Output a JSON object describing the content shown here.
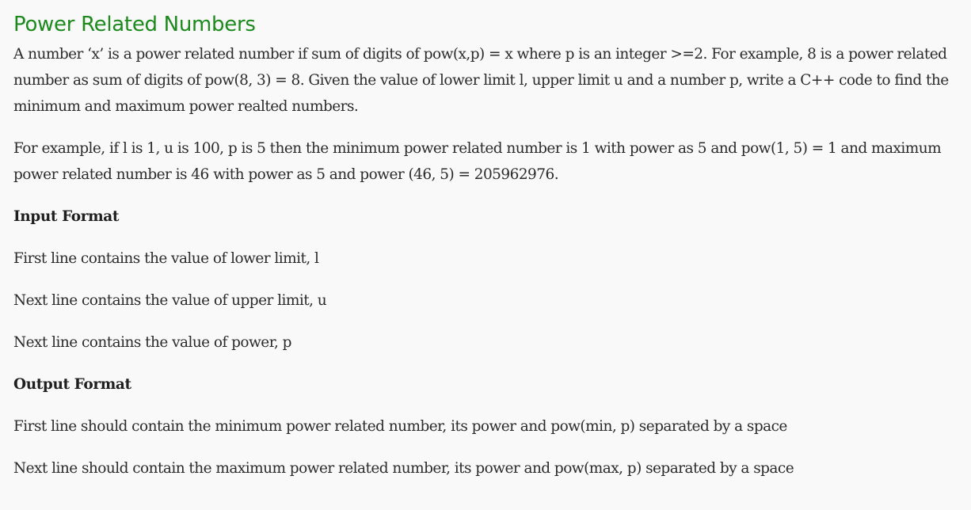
{
  "problem": {
    "title": "Power Related Numbers",
    "intro": "A number ‘x’ is a power related number if sum of digits of pow(x,p) = x where p is an integer >=2. For example, 8 is a power related number as sum of digits of pow(8, 3) = 8. Given the value of lower limit l, upper limit u and a number p, write a C++ code to find the minimum and maximum power realted numbers.",
    "example": "For example, if l is 1, u is 100, p is 5 then the minimum power related number is 1 with power as 5 and pow(1, 5) = 1 and maximum power related number is 46 with power as 5 and power (46, 5) = 205962976.",
    "input_heading": "Input Format",
    "input_lines": [
      "First line contains the value of lower limit, l",
      "Next line contains the value of upper limit, u",
      "Next line contains the value of power, p"
    ],
    "output_heading": "Output Format",
    "output_lines": [
      "First line should contain the minimum power related number, its power and pow(min, p) separated by a space",
      "Next line should contain the maximum power related number, its power and pow(max, p) separated by a space"
    ]
  },
  "colors": {
    "title": "#1c8a1c",
    "text": "#2b2b2b",
    "background": "#f9f9f9"
  }
}
